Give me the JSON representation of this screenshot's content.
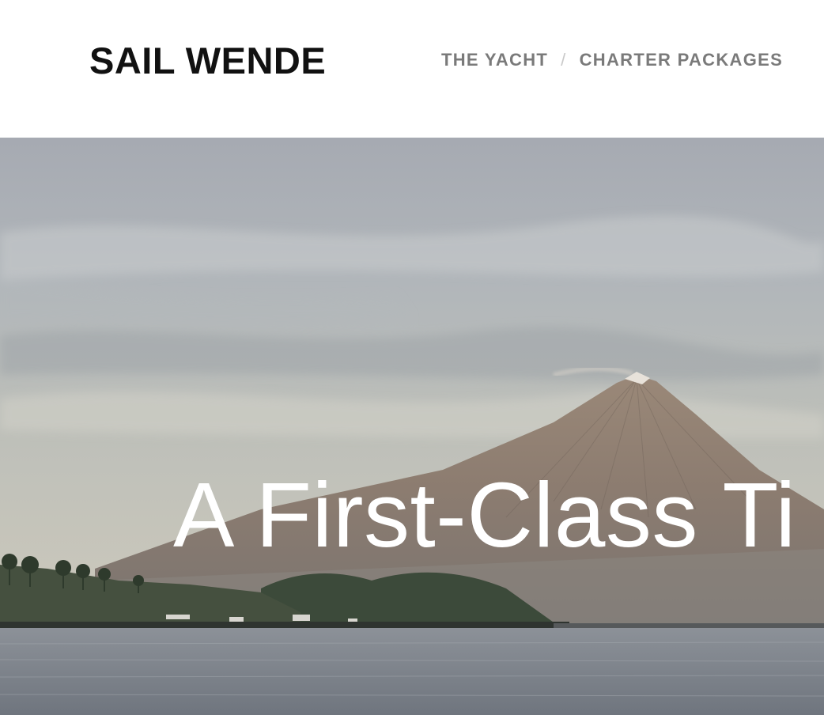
{
  "header": {
    "logo_text": "SAIL WENDE",
    "nav": [
      {
        "label": "THE YACHT"
      },
      {
        "separator": "/"
      },
      {
        "label": "CHARTER PACKAGES"
      }
    ]
  },
  "hero": {
    "title": "A First-Class Ti"
  },
  "colors": {
    "logo": "#111111",
    "nav_text": "#7a7a7a",
    "nav_separator": "#c9c9c9",
    "hero_text": "#ffffff"
  }
}
